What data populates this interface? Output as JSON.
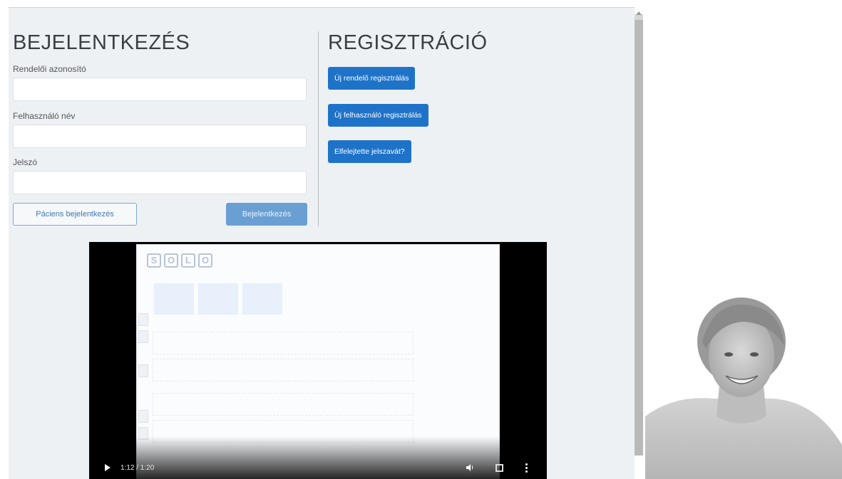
{
  "login": {
    "title": "BEJELENTKEZÉS",
    "practice_id_label": "Rendelői azonosító",
    "practice_id_value": "",
    "username_label": "Felhasználó név",
    "username_value": "",
    "password_label": "Jelszó",
    "password_value": "",
    "patient_login_button": "Páciens bejelentkezés",
    "login_button": "Bejelentkezés"
  },
  "registration": {
    "title": "REGISZTRÁCIÓ",
    "new_practice_button": "Új rendelő regisztrálás",
    "new_user_button": "Új felhasználó regisztrálás",
    "forgot_password_button": "Elfelejtette jelszavát?"
  },
  "video": {
    "logo_letters": [
      "S",
      "O",
      "L",
      "O"
    ],
    "time": "1:12 / 1:20",
    "icons": [
      "play-icon",
      "volume-icon",
      "fullscreen-icon",
      "more-options-icon"
    ]
  },
  "colors": {
    "primary_button": "#1e73c9",
    "login_button_disabled": "#6a9fd4",
    "outline_text": "#3f79b8",
    "panel_background": "#eef1f4"
  }
}
